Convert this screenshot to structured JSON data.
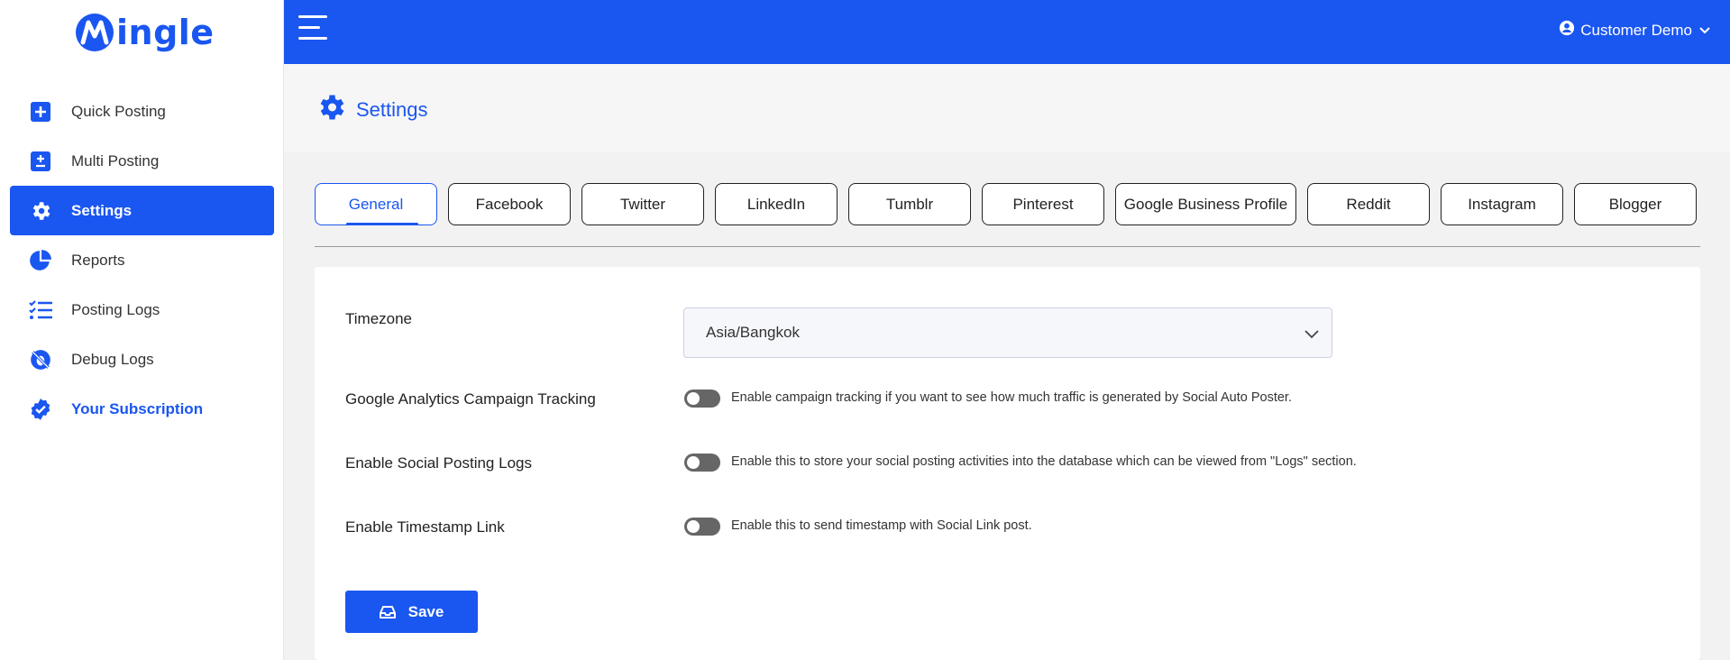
{
  "app": {
    "logo_text": "ingle",
    "logo_mark": "M"
  },
  "sidebar": {
    "items": [
      {
        "label": "Quick Posting",
        "icon": "plus-square-icon"
      },
      {
        "label": "Multi Posting",
        "icon": "plus-minus-square-icon"
      },
      {
        "label": "Settings",
        "icon": "gear-icon",
        "active": true
      },
      {
        "label": "Reports",
        "icon": "pie-chart-icon"
      },
      {
        "label": "Posting Logs",
        "icon": "checklist-icon"
      },
      {
        "label": "Debug Logs",
        "icon": "bug-slash-icon"
      },
      {
        "label": "Your Subscription",
        "icon": "verified-badge-icon"
      }
    ]
  },
  "header": {
    "user_name": "Customer Demo"
  },
  "page": {
    "title": "Settings"
  },
  "tabs": [
    "General",
    "Facebook",
    "Twitter",
    "LinkedIn",
    "Tumblr",
    "Pinterest",
    "Google Business Profile",
    "Reddit",
    "Instagram",
    "Blogger"
  ],
  "form": {
    "timezone": {
      "label": "Timezone",
      "value": "Asia/Bangkok"
    },
    "ga_tracking": {
      "label": "Google Analytics Campaign Tracking",
      "description": "Enable campaign tracking if you want to see how much traffic is generated by Social Auto Poster.",
      "enabled": false
    },
    "posting_logs": {
      "label": "Enable Social Posting Logs",
      "description": "Enable this to store your social posting activities into the database which can be viewed from \"Logs\" section.",
      "enabled": false
    },
    "timestamp_link": {
      "label": "Enable Timestamp Link",
      "description": "Enable this to send timestamp with Social Link post.",
      "enabled": false
    },
    "save_label": "Save"
  },
  "colors": {
    "accent": "#1a56f0",
    "toggle_off": "#666666"
  }
}
